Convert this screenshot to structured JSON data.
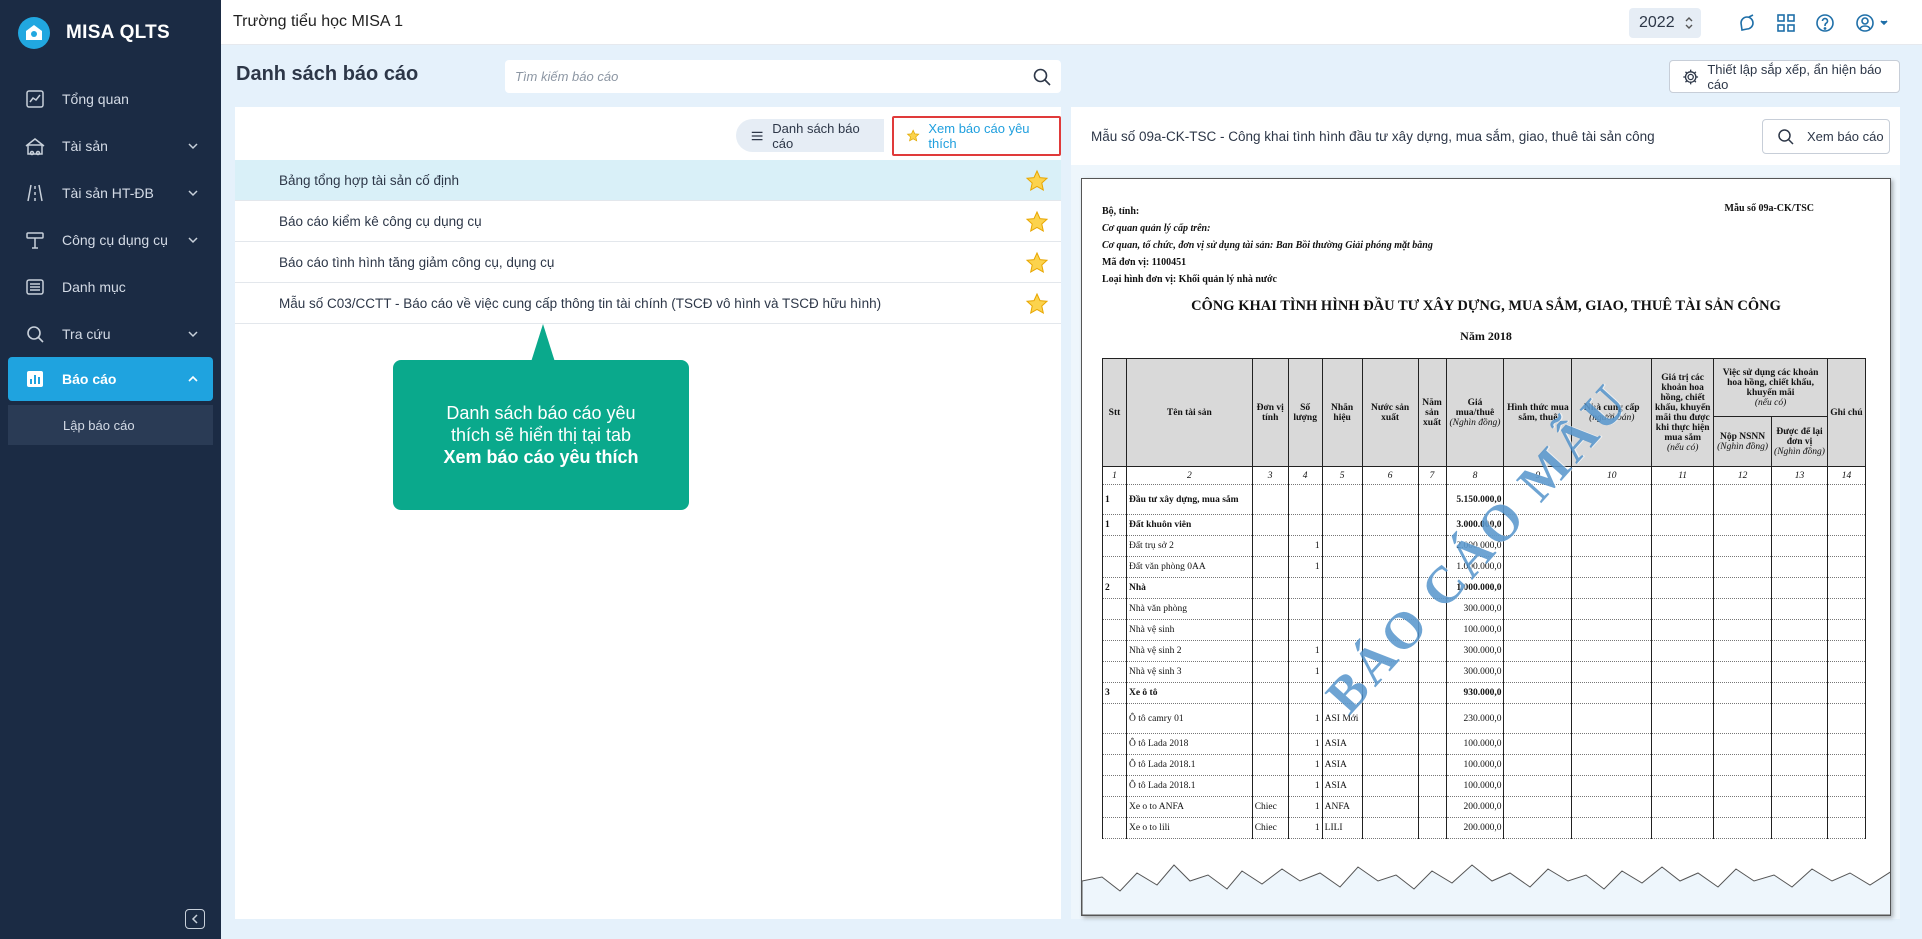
{
  "app": {
    "name": "MISA QLTS"
  },
  "sidebar": {
    "items": [
      {
        "label": "Tổng quan",
        "icon": "dashboard-chart-icon"
      },
      {
        "label": "Tài sản",
        "icon": "asset-house-icon",
        "expandable": true
      },
      {
        "label": "Tài sản HT-ĐB",
        "icon": "road-icon",
        "expandable": true
      },
      {
        "label": "Công cụ dụng cụ",
        "icon": "tools-icon",
        "expandable": true
      },
      {
        "label": "Danh mục",
        "icon": "list-icon"
      },
      {
        "label": "Tra cứu",
        "icon": "search-icon",
        "expandable": true
      },
      {
        "label": "Báo cáo",
        "icon": "report-bar-icon",
        "expandable": true,
        "active": true
      }
    ],
    "sub_items": [
      {
        "label": "Lập báo cáo"
      }
    ]
  },
  "header": {
    "org_name": "Trường tiểu học MISA 1",
    "year": "2022"
  },
  "page": {
    "title": "Danh sách báo cáo",
    "search_placeholder": "Tìm kiếm báo cáo",
    "settings_label": "Thiết lập sắp xếp, ẩn hiện báo cáo"
  },
  "tabs": {
    "list_label": "Danh sách báo cáo",
    "favorite_label": "Xem báo cáo yêu thích"
  },
  "reports": [
    {
      "name": "Bảng tổng hợp tài sản cố định",
      "favorite": true,
      "selected": true
    },
    {
      "name": "Báo cáo kiểm kê công cụ dụng cụ",
      "favorite": true
    },
    {
      "name": "Báo cáo tình hình tăng giảm công cụ, dụng cụ",
      "favorite": true
    },
    {
      "name": "Mẫu số C03/CCTT - Báo cáo về việc cung cấp thông tin tài chính (TSCĐ vô hình và TSCĐ hữu hình)",
      "favorite": true
    }
  ],
  "callout": {
    "line1": "Danh sách báo cáo yêu",
    "line2": "thích sẽ hiển thị tại tab",
    "line3": "Xem báo cáo yêu thích"
  },
  "preview": {
    "header_title": "Mẫu số 09a-CK-TSC - Công khai tình hình đầu tư xây dựng, mua sắm, giao, thuê tài sản công",
    "view_button": "Xem báo cáo",
    "watermark": "BÁO CÁO MẪU",
    "doc": {
      "meta": [
        "Bộ, tỉnh:",
        "Cơ quan quản lý cấp trên:",
        "Cơ quan, tổ chức, đơn vị sử dụng tài sản: Ban Bồi thường Giải phóng mặt bằng",
        "Mã đơn vị: 1100451",
        "Loại hình đơn vị: Khối quản lý nhà nước"
      ],
      "form_no": "Mẫu số 09a-CK/TSC",
      "title": "CÔNG KHAI TÌNH HÌNH ĐẦU TƯ XÂY DỰNG, MUA SẮM, GIAO, THUÊ TÀI SẢN CÔNG",
      "year": "Năm 2018",
      "columns": {
        "stt": "Stt",
        "name": "Tên tài sản",
        "unit": "Đơn vị tính",
        "qty": "Số lượng",
        "brand": "Nhãn hiệu",
        "country": "Nước sản xuất",
        "year": "Năm sản xuất",
        "price": "Giá mua/thuê",
        "price_unit": "(Nghìn đồng)",
        "method": "Hình thức mua sắm, thuê",
        "supplier": "Nhà cung cấp",
        "supplier_sub": "(người bán)",
        "discount": "Giá trị các khoản hoa hồng, chiết khấu, khuyến mãi thu được khi thực hiện mua sắm",
        "discount_sub": "(nếu có)",
        "usage": "Việc sử dụng các khoản hoa hồng, chiết khấu, khuyến mãi",
        "usage_sub": "(nếu có)",
        "nsnn": "Nộp NSNN",
        "nsnn_sub": "(Nghìn đồng)",
        "keep": "Được để lại đơn vị",
        "keep_sub": "(Nghìn đồng)",
        "note": "Ghi chú"
      },
      "index_row": [
        "1",
        "2",
        "3",
        "4",
        "5",
        "6",
        "7",
        "8",
        "9",
        "10",
        "11",
        "12",
        "13",
        "14"
      ],
      "rows": [
        {
          "stt": "1",
          "name": "Đầu tư xây dựng, mua sắm",
          "unit": "",
          "qty": "",
          "brand": "",
          "price": "5.150.000,0",
          "bold": true,
          "tall": true
        },
        {
          "stt": "1",
          "name": "Đất khuôn viên",
          "unit": "",
          "qty": "",
          "brand": "",
          "price": "3.000.000,0",
          "bold": true
        },
        {
          "stt": "",
          "name": "Đất trụ sở 2",
          "unit": "",
          "qty": "1",
          "brand": "",
          "price": "2.000.000,0"
        },
        {
          "stt": "",
          "name": "Đất văn phòng 0AA",
          "unit": "",
          "qty": "1",
          "brand": "",
          "price": "1.000.000,0"
        },
        {
          "stt": "2",
          "name": "Nhà",
          "unit": "",
          "qty": "",
          "brand": "",
          "price": "1.000.000,0",
          "bold": true
        },
        {
          "stt": "",
          "name": "Nhà văn phòng",
          "unit": "",
          "qty": "",
          "brand": "",
          "price": "300.000,0"
        },
        {
          "stt": "",
          "name": "Nhà vệ sinh",
          "unit": "",
          "qty": "",
          "brand": "",
          "price": "100.000,0"
        },
        {
          "stt": "",
          "name": "Nhà vệ sinh 2",
          "unit": "",
          "qty": "1",
          "brand": "",
          "price": "300.000,0"
        },
        {
          "stt": "",
          "name": "Nhà vệ sinh 3",
          "unit": "",
          "qty": "1",
          "brand": "",
          "price": "300.000,0"
        },
        {
          "stt": "3",
          "name": "Xe ô tô",
          "unit": "",
          "qty": "",
          "brand": "",
          "price": "930.000,0",
          "bold": true
        },
        {
          "stt": "",
          "name": "Ô tô camry 01",
          "unit": "",
          "qty": "1",
          "brand": "ASI Mới",
          "price": "230.000,0",
          "tall": true
        },
        {
          "stt": "",
          "name": "Ô tô Lada 2018",
          "unit": "",
          "qty": "1",
          "brand": "ASIA",
          "price": "100.000,0"
        },
        {
          "stt": "",
          "name": "Ô tô Lada 2018.1",
          "unit": "",
          "qty": "1",
          "brand": "ASIA",
          "price": "100.000,0"
        },
        {
          "stt": "",
          "name": "Ô tô Lada 2018.1",
          "unit": "",
          "qty": "1",
          "brand": "ASIA",
          "price": "100.000,0"
        },
        {
          "stt": "",
          "name": "Xe o to ANFA",
          "unit": "Chiec",
          "qty": "1",
          "brand": "ANFA",
          "price": "200.000,0"
        },
        {
          "stt": "",
          "name": "Xe o to lili",
          "unit": "Chiec",
          "qty": "1",
          "brand": "LILI",
          "price": "200.000,0"
        }
      ]
    }
  },
  "colors": {
    "sidebar_bg": "#1b2b44",
    "accent": "#1fa3df",
    "callout": "#0aa98c",
    "star": "#f5c518"
  }
}
